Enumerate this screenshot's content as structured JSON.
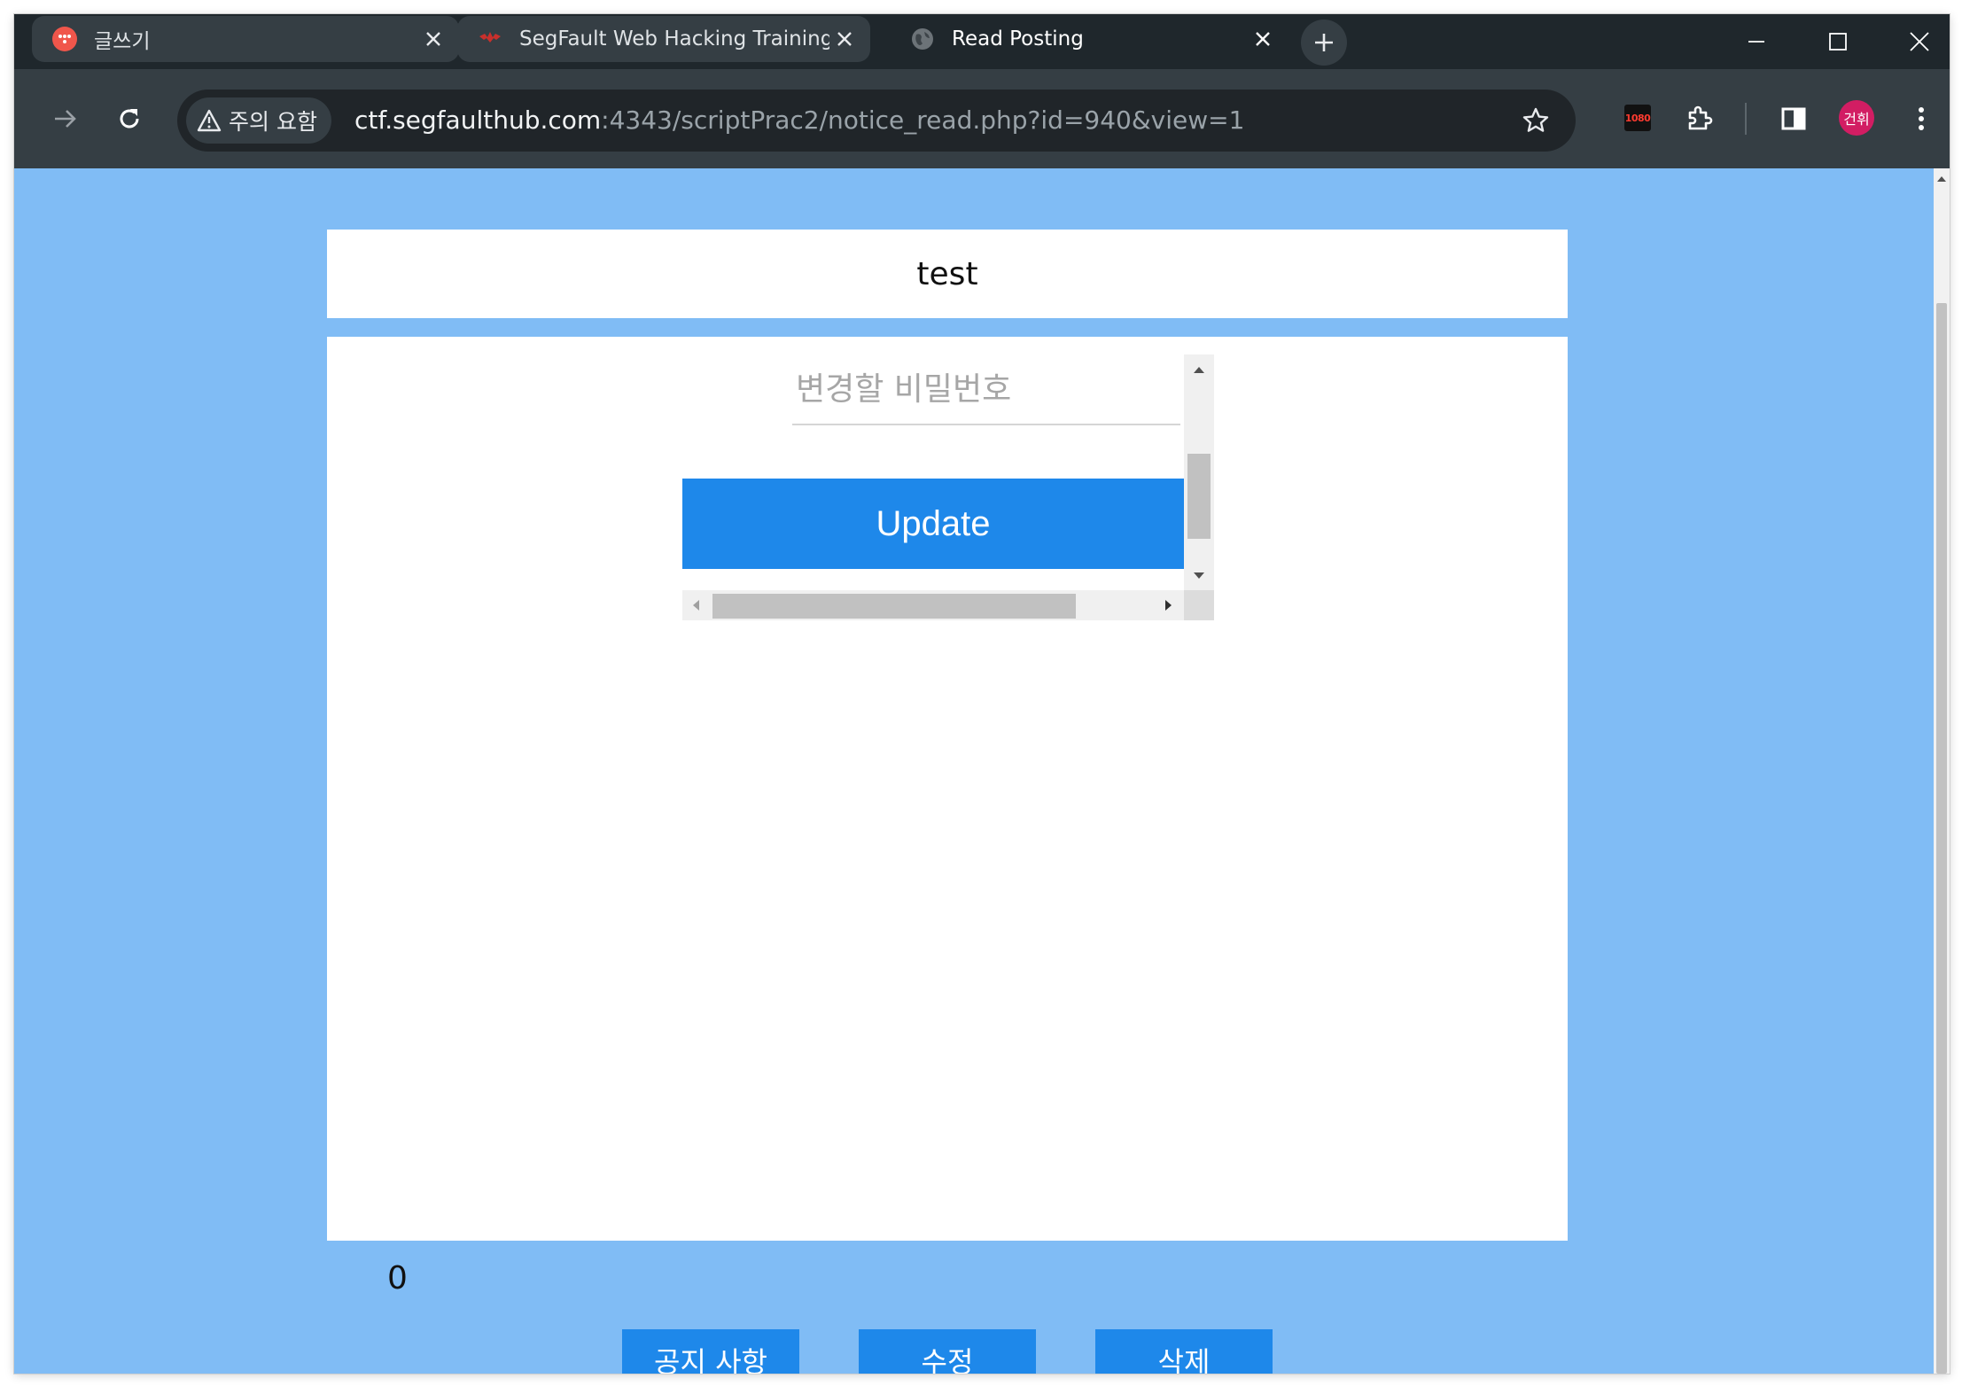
{
  "browser": {
    "tabs": [
      {
        "title": "글쓰기",
        "favicon": "velog-icon",
        "active": false
      },
      {
        "title": "SegFault Web Hacking Training",
        "favicon": "segfault-bat-icon",
        "active": false
      },
      {
        "title": "Read Posting",
        "favicon": "globe-icon",
        "active": true
      }
    ],
    "address_bar": {
      "security_chip": "주의 요함",
      "url_host": "ctf.segfaulthub.com",
      "url_rest": ":4343/scriptPrac2/notice_read.php?id=940&view=1"
    },
    "extension_badge": "1080",
    "profile_initials": "건휘"
  },
  "page": {
    "post_title": "test",
    "embedded_form": {
      "password_placeholder": "변경할 비밀번호",
      "update_button": "Update"
    },
    "counter": "0",
    "buttons": {
      "notice": "공지 사항",
      "edit": "수정",
      "delete": "삭제"
    }
  },
  "colors": {
    "page_background": "#80bcf5",
    "button_blue": "#1e88ea",
    "tab_strip": "#1f272c",
    "toolbar": "#353e44",
    "avatar": "#d21d63"
  }
}
